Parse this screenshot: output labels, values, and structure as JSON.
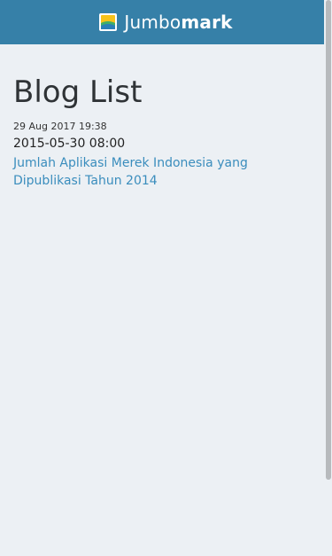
{
  "header": {
    "logo_icon": "jumbomark-logo-icon",
    "brand_light": "Jumbo",
    "brand_bold": "mark",
    "background_color": "#3680a8"
  },
  "main": {
    "title": "Blog List",
    "posts": [
      {
        "meta": "29 Aug 2017 19:38",
        "date": "2015-05-30 08:00",
        "title": "Jumlah Aplikasi Merek Indonesia yang Dipublikasi Tahun 2014"
      }
    ]
  },
  "colors": {
    "link": "#3a8dbd",
    "page_background": "#ecf0f4"
  }
}
